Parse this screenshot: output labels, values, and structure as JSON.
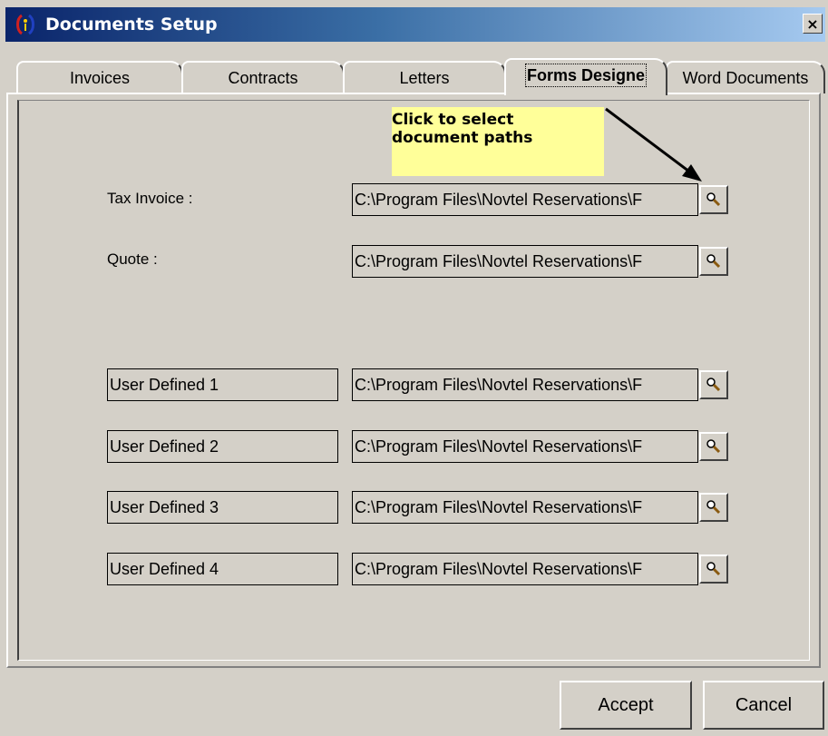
{
  "window": {
    "title": "Documents Setup",
    "close_label": "×",
    "app_icon": "app-logo-icon"
  },
  "tabs": [
    {
      "label": "Invoices",
      "active": false
    },
    {
      "label": "Contracts",
      "active": false
    },
    {
      "label": "Letters",
      "active": false
    },
    {
      "label": "Forms Designe",
      "active": true
    },
    {
      "label": "Word Documents",
      "active": false
    }
  ],
  "callout": {
    "text": "Click to select\ndocument paths"
  },
  "documents": {
    "tax_invoice": {
      "label": "Tax Invoice :",
      "path": "C:\\Program Files\\Novtel Reservations\\F"
    },
    "quote": {
      "label": "Quote :",
      "path": "C:\\Program Files\\Novtel Reservations\\F"
    },
    "user_defined": [
      {
        "name": "User Defined 1",
        "path": "C:\\Program Files\\Novtel Reservations\\F"
      },
      {
        "name": "User Defined 2",
        "path": "C:\\Program Files\\Novtel Reservations\\F"
      },
      {
        "name": "User Defined 3",
        "path": "C:\\Program Files\\Novtel Reservations\\F"
      },
      {
        "name": "User Defined 4",
        "path": "C:\\Program Files\\Novtel Reservations\\F"
      }
    ],
    "browse_icon": "magnifier-icon"
  },
  "buttons": {
    "accept": "Accept",
    "cancel": "Cancel"
  },
  "colors": {
    "titlebar_start": "#0a246a",
    "titlebar_end": "#a6caf0",
    "face": "#d4d0c8",
    "callout": "#ffff99"
  }
}
